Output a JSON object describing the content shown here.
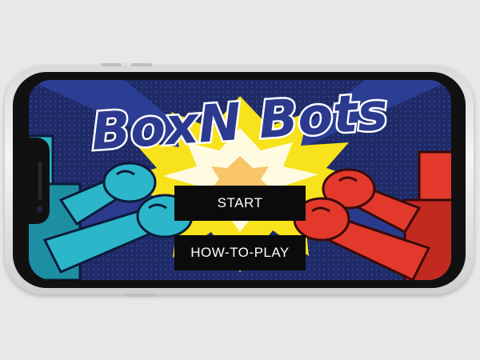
{
  "game": {
    "title": "BoxN Bots"
  },
  "menu": {
    "start_label": "START",
    "howto_label": "HOW-TO-PLAY"
  },
  "colors": {
    "background": "#e8e8e6",
    "screen_bg": "#1f2b66",
    "burst_yellow": "#f7e21b",
    "title_fill": "#2b3a8f",
    "title_outline": "#ffffff",
    "blue_robot": "#2bb6c9",
    "red_robot": "#e2392c",
    "button_bg": "#0b0b0b",
    "button_text": "#ffffff"
  }
}
